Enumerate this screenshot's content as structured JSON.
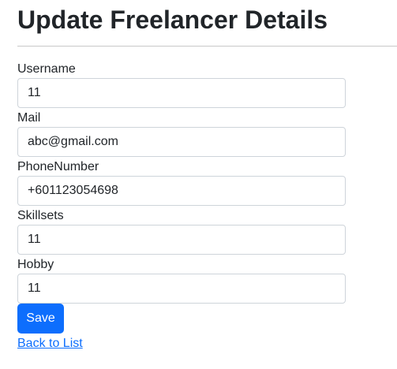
{
  "page": {
    "title": "Update Freelancer Details"
  },
  "form": {
    "fields": [
      {
        "label": "Username",
        "value": "11"
      },
      {
        "label": "Mail",
        "value": "abc@gmail.com"
      },
      {
        "label": "PhoneNumber",
        "value": "+601123054698"
      },
      {
        "label": "Skillsets",
        "value": "11"
      },
      {
        "label": "Hobby",
        "value": "11"
      }
    ],
    "save_label": "Save"
  },
  "links": {
    "back_label": "Back to List"
  },
  "colors": {
    "primary": "#0d6efd",
    "text": "#212529",
    "input_border": "#ced4da"
  }
}
